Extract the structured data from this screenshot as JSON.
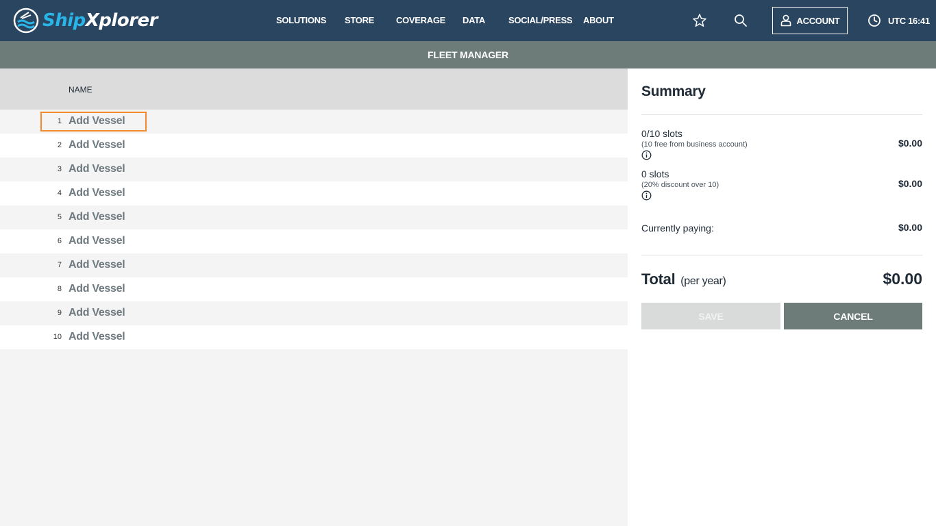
{
  "header": {
    "logo": {
      "part1": "Ship",
      "part2": "Xplorer"
    },
    "nav": [
      "SOLUTIONS",
      "STORE",
      "COVERAGE",
      "DATA",
      "SOCIAL/PRESS",
      "ABOUT"
    ],
    "account_label": "ACCOUNT",
    "clock": "UTC 16:41"
  },
  "subheader": {
    "title": "FLEET MANAGER"
  },
  "list": {
    "column_header": "NAME",
    "rows": [
      {
        "num": "1",
        "label": "Add Vessel"
      },
      {
        "num": "2",
        "label": "Add Vessel"
      },
      {
        "num": "3",
        "label": "Add Vessel"
      },
      {
        "num": "4",
        "label": "Add Vessel"
      },
      {
        "num": "5",
        "label": "Add Vessel"
      },
      {
        "num": "6",
        "label": "Add Vessel"
      },
      {
        "num": "7",
        "label": "Add Vessel"
      },
      {
        "num": "8",
        "label": "Add Vessel"
      },
      {
        "num": "9",
        "label": "Add Vessel"
      },
      {
        "num": "10",
        "label": "Add Vessel"
      }
    ]
  },
  "summary": {
    "title": "Summary",
    "slots_line": {
      "main": "0/10 slots",
      "sub": "(10 free from business account)",
      "price": "$0.00"
    },
    "discount_line": {
      "main": "0 slots",
      "sub": "(20% discount over 10)",
      "price": "$0.00"
    },
    "paying_line": {
      "main": "Currently paying:",
      "price": "$0.00"
    },
    "total": {
      "label": "Total",
      "period": "(per year)",
      "price": "$0.00"
    },
    "save_label": "SAVE",
    "cancel_label": "CANCEL"
  },
  "colors": {
    "topbar": "#2a4560",
    "subbar": "#6d7c78",
    "accent": "#29b5e8",
    "focus": "#f38a2c"
  },
  "icons": [
    "logo-icon",
    "star-icon",
    "search-icon",
    "user-icon",
    "clock-icon",
    "info-icon"
  ]
}
